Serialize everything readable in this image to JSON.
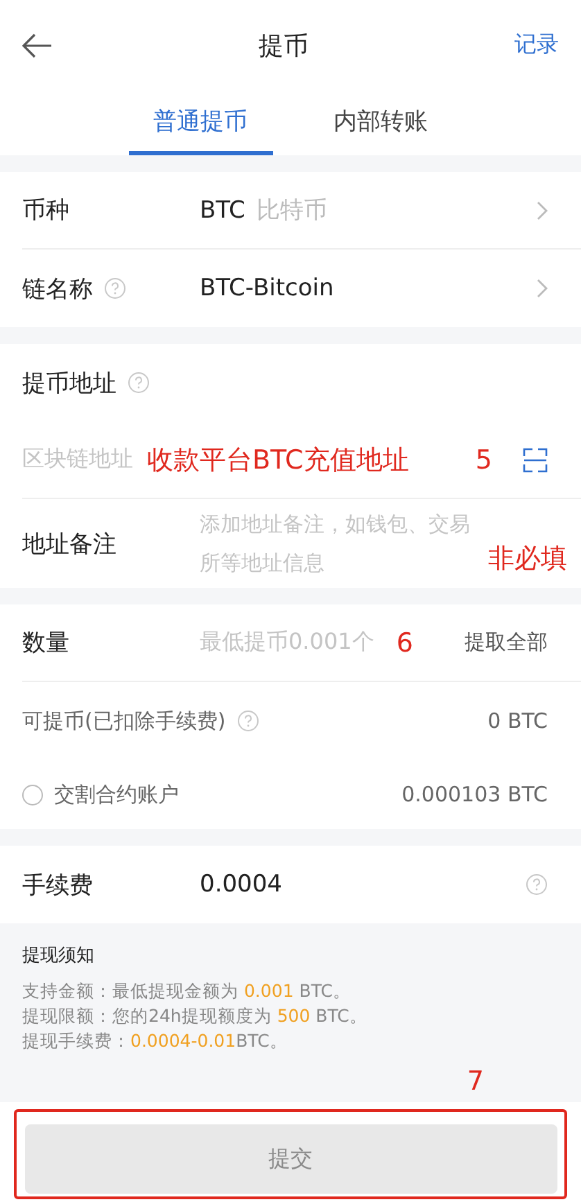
{
  "header": {
    "title": "提币",
    "action": "记录"
  },
  "tabs": [
    {
      "label": "普通提币",
      "selected": true
    },
    {
      "label": "内部转账",
      "selected": false
    }
  ],
  "currency": {
    "label": "币种",
    "value": "BTC",
    "name": "比特币"
  },
  "chain": {
    "label": "链名称",
    "value": "BTC-Bitcoin"
  },
  "address": {
    "label": "提币地址",
    "placeholder": "区块链地址",
    "annotation": "收款平台BTC充值地址",
    "annotation_step": "5"
  },
  "memo": {
    "label": "地址备注",
    "placeholder": "添加地址备注，如钱包、交易所等地址信息",
    "annotation": "非必填"
  },
  "amount": {
    "label": "数量",
    "placeholder": "最低提币0.001个",
    "annotation_step": "6",
    "action": "提取全部"
  },
  "available": {
    "label": "可提币(已扣除手续费)",
    "value": "0 BTC"
  },
  "futures_account": {
    "label": "交割合约账户",
    "value": "0.000103 BTC",
    "checked": false
  },
  "fee": {
    "label": "手续费",
    "value": "0.0004"
  },
  "notice": {
    "title": "提现须知",
    "lines": [
      [
        {
          "text": "支持金额：最低提现金额为 ",
          "highlight": false
        },
        {
          "text": "0.001",
          "highlight": true
        },
        {
          "text": " BTC。",
          "highlight": false
        }
      ],
      [
        {
          "text": "提现限额：您的24h提现额度为 ",
          "highlight": false
        },
        {
          "text": "500",
          "highlight": true
        },
        {
          "text": " BTC。",
          "highlight": false
        }
      ],
      [
        {
          "text": "提现手续费：",
          "highlight": false
        },
        {
          "text": "0.0004-0.01",
          "highlight": true
        },
        {
          "text": "BTC。",
          "highlight": false
        }
      ]
    ]
  },
  "submit": {
    "label": "提交",
    "disabled": true,
    "annotation_step": "7"
  }
}
